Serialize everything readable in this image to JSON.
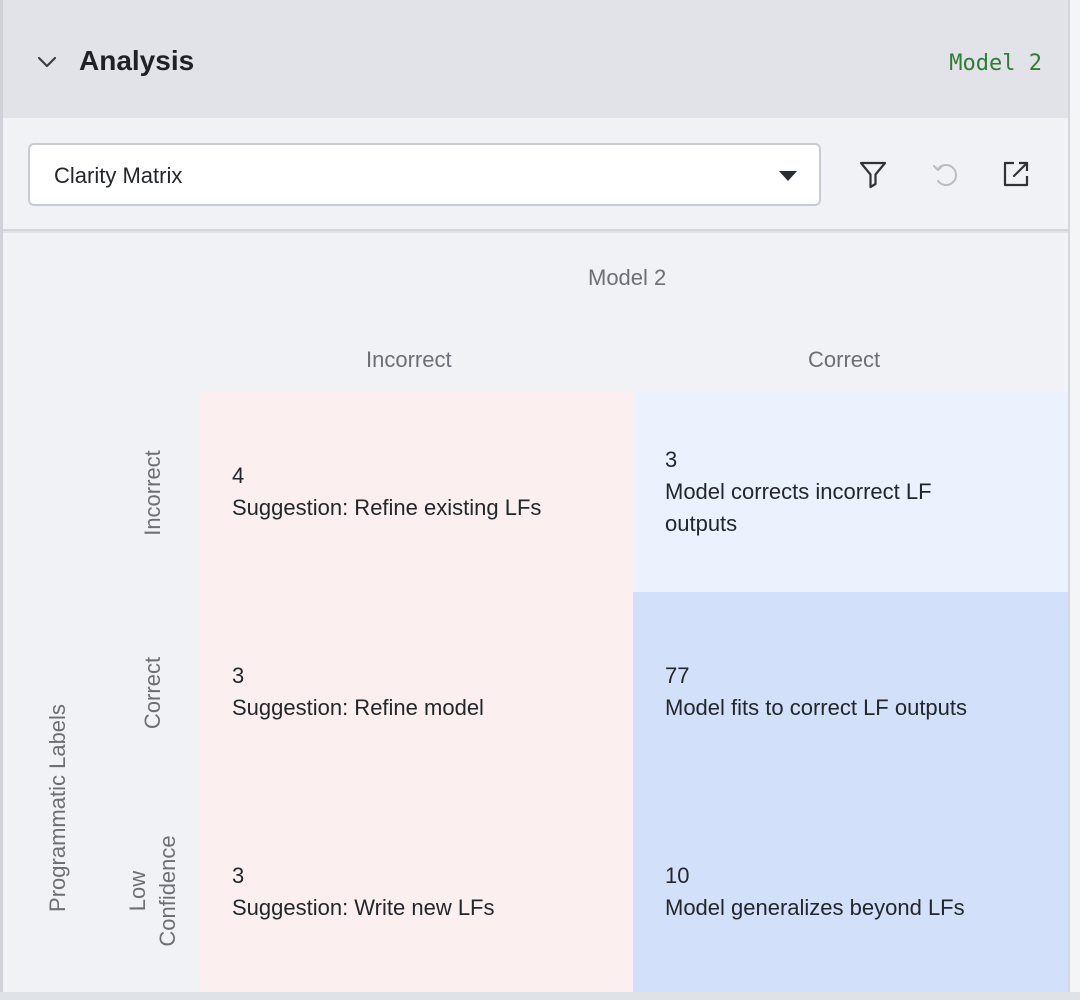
{
  "header": {
    "title": "Analysis",
    "model_tag": "Model 2",
    "toggle_icon": "chevron-down-icon"
  },
  "toolbar": {
    "select_value": "Clarity Matrix",
    "icons": [
      "filter-icon",
      "undo-icon",
      "open-external-icon"
    ]
  },
  "matrix": {
    "column_axis_label": "Model 2",
    "row_axis_label": "Programmatic Labels",
    "columns": [
      "Incorrect",
      "Correct"
    ],
    "rows": [
      "Incorrect",
      "Correct",
      "Low Confidence"
    ],
    "row_label_low_line1": "Low",
    "row_label_low_line2": "Confidence",
    "cells": [
      [
        {
          "count": "4",
          "text": "Suggestion: Refine existing LFs"
        },
        {
          "count": "3",
          "text": "Model corrects incorrect LF outputs"
        }
      ],
      [
        {
          "count": "3",
          "text": "Suggestion: Refine model"
        },
        {
          "count": "77",
          "text": "Model fits to correct LF outputs"
        }
      ],
      [
        {
          "count": "3",
          "text": "Suggestion: Write new LFs"
        },
        {
          "count": "10",
          "text": "Model generalizes beyond LFs"
        }
      ]
    ],
    "colors": {
      "incorrect_column": "#fbefef",
      "correct_incorrect_cell": "#ebf2fe",
      "correct_cells": "#d2e0f9"
    }
  }
}
